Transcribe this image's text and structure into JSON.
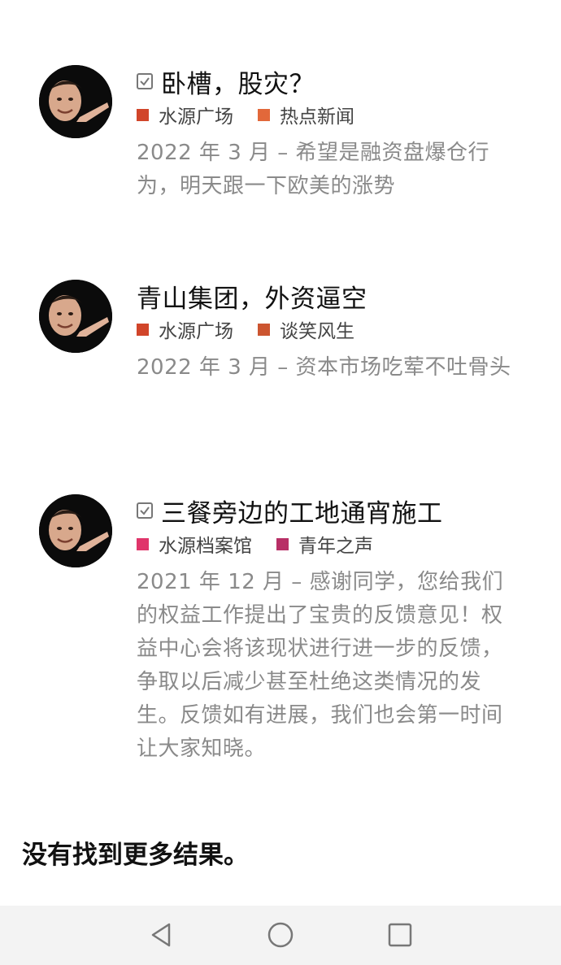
{
  "results": [
    {
      "title": "卧槽，股灾？",
      "checked": true,
      "tags": [
        {
          "label": "水源广场",
          "color": "#d1452a"
        },
        {
          "label": "热点新闻",
          "color": "#e2683a"
        }
      ],
      "excerpt": "2022 年 3 月 – 希望是融资盘爆仓行为，明天跟一下欧美的涨势"
    },
    {
      "title": "青山集团，外资逼空",
      "checked": false,
      "tags": [
        {
          "label": "水源广场",
          "color": "#d1452a"
        },
        {
          "label": "谈笑风生",
          "color": "#cc5530"
        }
      ],
      "excerpt": "2022 年 3 月 – 资本市场吃荤不吐骨头"
    },
    {
      "title": "三餐旁边的工地通宵施工",
      "checked": true,
      "tags": [
        {
          "label": "水源档案馆",
          "color": "#e0356a"
        },
        {
          "label": "青年之声",
          "color": "#b82f66"
        }
      ],
      "excerpt": "2021 年 12 月 – 感谢同学，您给我们的权益工作提出了宝贵的反馈意见！权益中心会将该现状进行进一步的反馈，争取以后减少甚至杜绝这类情况的发生。反馈如有进展，我们也会第一时间让大家知晓。"
    }
  ],
  "end_message": "没有找到更多结果。",
  "navbar": {
    "back": "back-icon",
    "home": "home-icon",
    "recents": "recents-icon"
  }
}
